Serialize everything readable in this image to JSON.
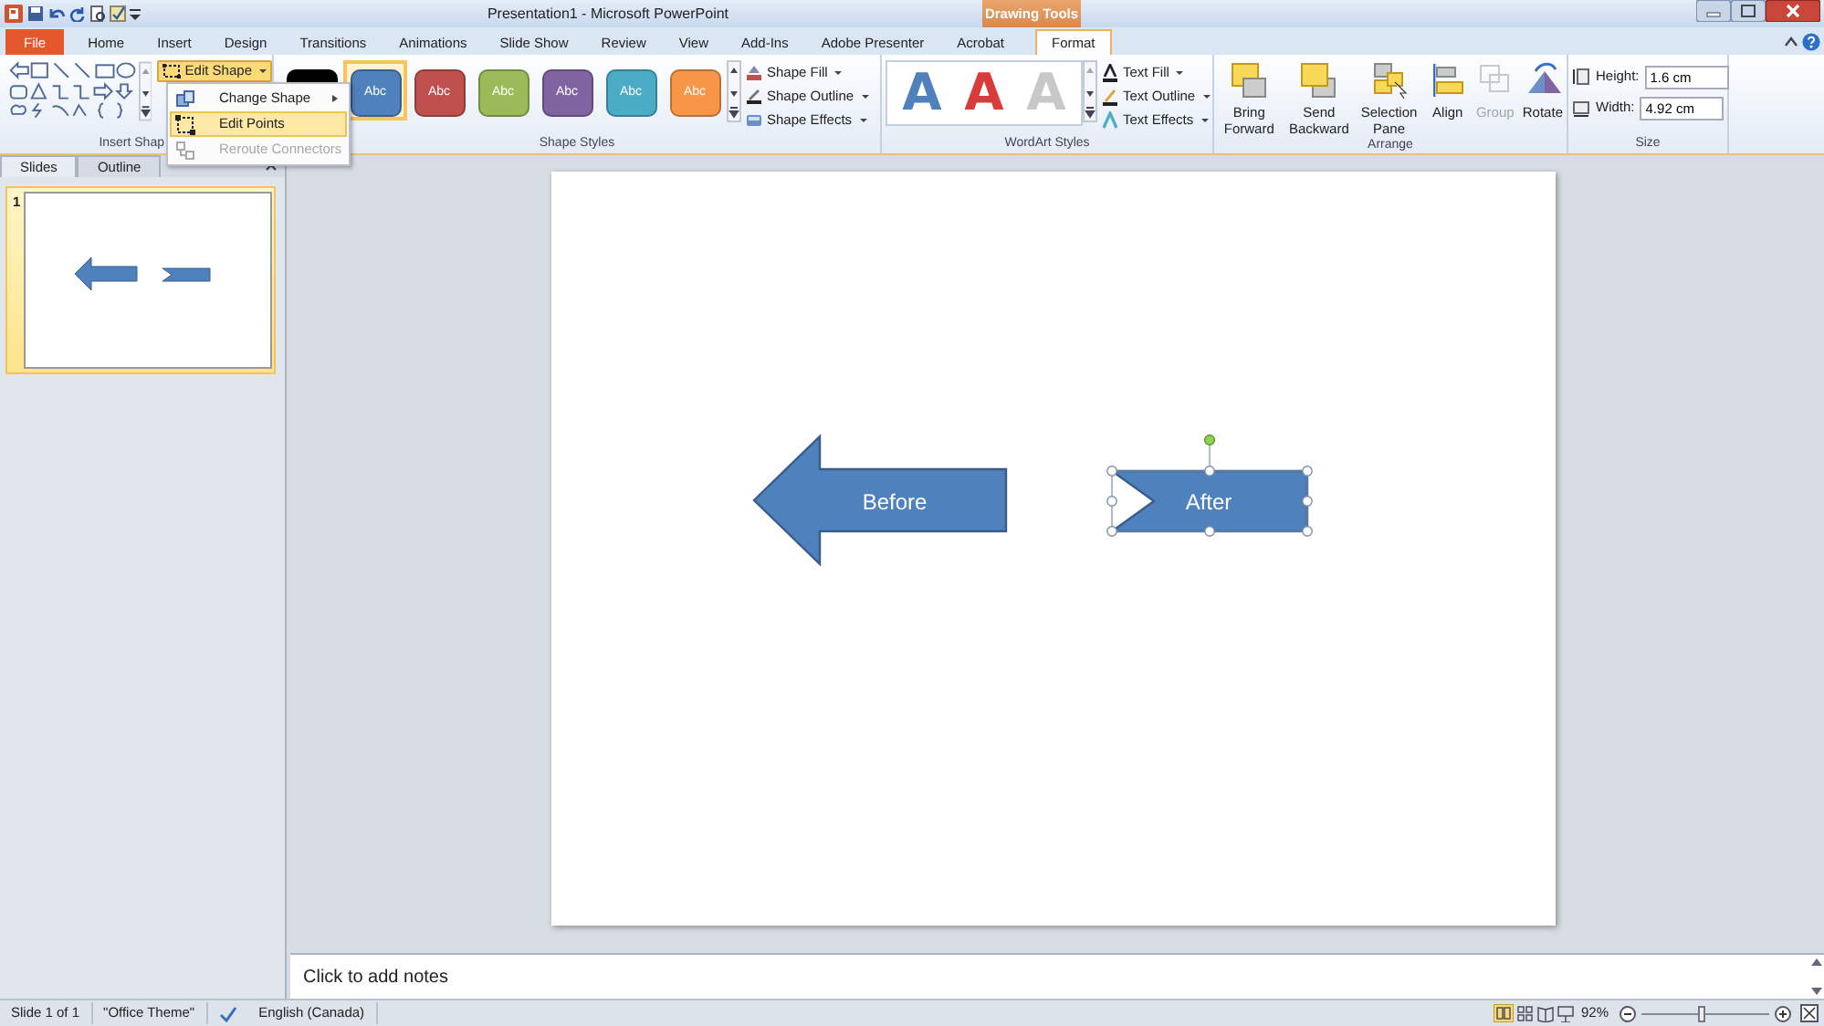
{
  "window": {
    "title": "Presentation1 - Microsoft PowerPoint",
    "context_tab": "Drawing Tools"
  },
  "tabs": [
    {
      "label": "File",
      "kind": "file",
      "selected": false
    },
    {
      "label": "Home",
      "selected": false
    },
    {
      "label": "Insert",
      "selected": false
    },
    {
      "label": "Design",
      "selected": false
    },
    {
      "label": "Transitions",
      "selected": false
    },
    {
      "label": "Animations",
      "selected": false
    },
    {
      "label": "Slide Show",
      "selected": false
    },
    {
      "label": "Review",
      "selected": false
    },
    {
      "label": "View",
      "selected": false
    },
    {
      "label": "Add-Ins",
      "selected": false
    },
    {
      "label": "Adobe Presenter",
      "selected": false
    },
    {
      "label": "Acrobat",
      "selected": false
    },
    {
      "label": "Format",
      "kind": "context",
      "selected": true
    }
  ],
  "ribbon": {
    "insert_shapes": {
      "label": "Insert Shap"
    },
    "edit_shape": {
      "label": "Edit Shape"
    },
    "shape_styles": {
      "label": "Shape Styles",
      "swatches": [
        {
          "color": "#000000",
          "selected": false
        },
        {
          "text": "Abc",
          "color": "#4f81bd",
          "selected": true
        },
        {
          "text": "Abc",
          "color": "#c0504d",
          "selected": false
        },
        {
          "text": "Abc",
          "color": "#9bbb59",
          "selected": false
        },
        {
          "text": "Abc",
          "color": "#8064a2",
          "selected": false
        },
        {
          "text": "Abc",
          "color": "#4bacc6",
          "selected": false
        },
        {
          "text": "Abc",
          "color": "#f79646",
          "selected": false
        }
      ],
      "commands": [
        "Shape Fill",
        "Shape Outline",
        "Shape Effects"
      ]
    },
    "wordart_styles": {
      "label": "WordArt Styles",
      "styles": [
        {
          "text": "A",
          "color": "#4f81bd"
        },
        {
          "text": "A",
          "color": "#d93b3b"
        },
        {
          "text": "A",
          "color": "#c8c8c8"
        }
      ],
      "commands": [
        "Text Fill",
        "Text Outline",
        "Text Effects"
      ]
    },
    "arrange": {
      "label": "Arrange",
      "buttons": [
        {
          "label": "Bring Forward",
          "disabled": false
        },
        {
          "label": "Send Backward",
          "disabled": false
        },
        {
          "label": "Selection Pane",
          "disabled": false
        },
        {
          "label": "Align",
          "disabled": false
        },
        {
          "label": "Group",
          "disabled": true
        },
        {
          "label": "Rotate",
          "disabled": false
        }
      ]
    },
    "size": {
      "label": "Size",
      "fields": [
        {
          "label": "Height:",
          "value": "1.6 cm"
        },
        {
          "label": "Width:",
          "value": "4.92 cm"
        }
      ]
    }
  },
  "menu": {
    "items": [
      {
        "label": "Change Shape",
        "submenu": true,
        "selected": false,
        "disabled": false
      },
      {
        "label": "Edit Points",
        "submenu": false,
        "selected": true,
        "disabled": false
      },
      {
        "label": "Reroute Connectors",
        "submenu": false,
        "selected": false,
        "disabled": true
      }
    ]
  },
  "side_panel": {
    "tabs": [
      {
        "label": "Slides",
        "selected": true
      },
      {
        "label": "Outline",
        "selected": false
      }
    ],
    "slides": [
      {
        "number": "1",
        "selected": true
      }
    ]
  },
  "slide": {
    "shapes": [
      {
        "kind": "left-arrow",
        "text": "Before",
        "selected": false
      },
      {
        "kind": "notched-rect",
        "text": "After",
        "selected": true
      }
    ]
  },
  "notes": {
    "placeholder": "Click to add notes"
  },
  "status_bar": {
    "slide": "Slide 1 of 1",
    "theme": "\"Office Theme\"",
    "language": "English (Canada)",
    "zoom": "92%",
    "zoom_slider": {
      "level": 0.47
    }
  }
}
